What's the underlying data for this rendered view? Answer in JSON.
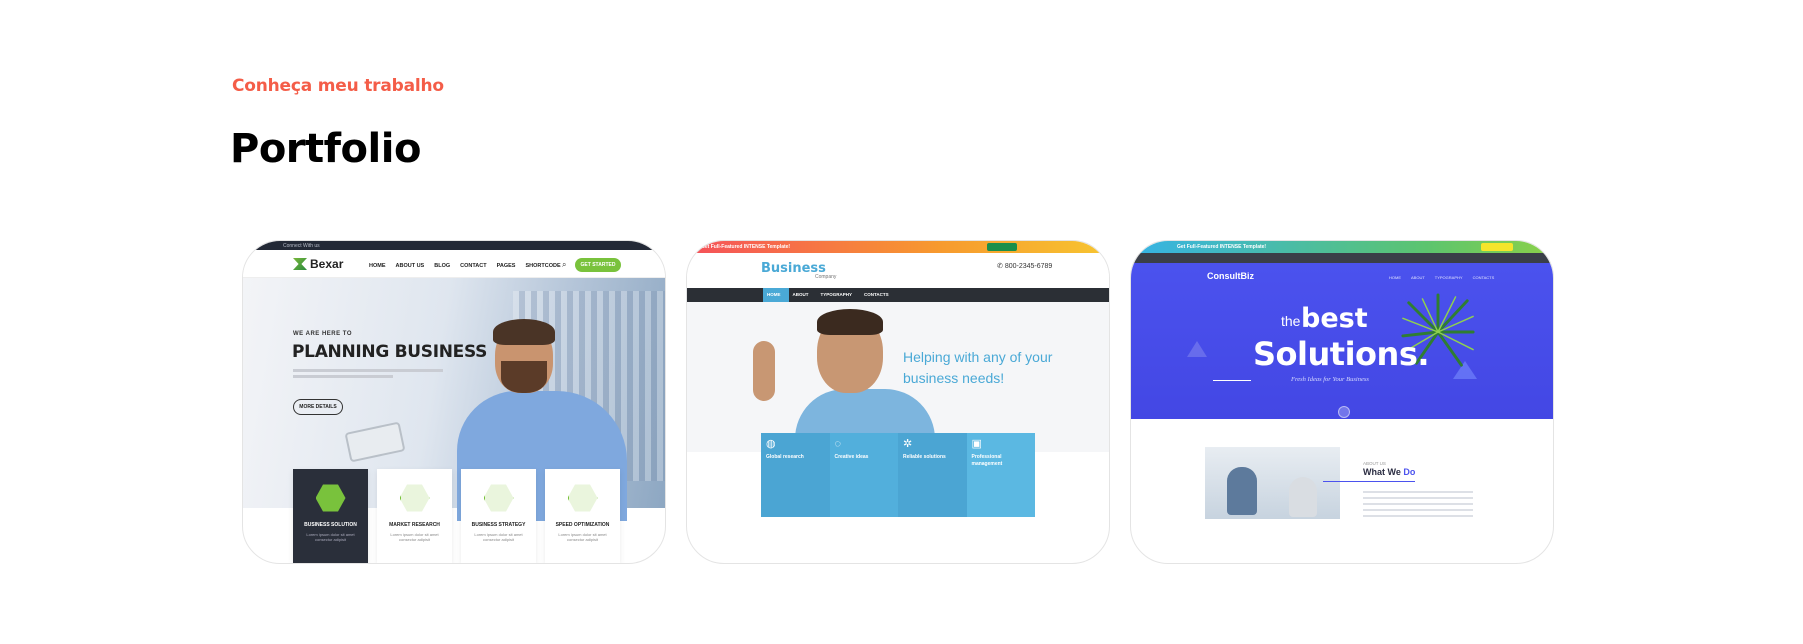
{
  "section": {
    "eyebrow": "Conheça meu trabalho",
    "title": "Portfolio"
  },
  "colors": {
    "accent": "#f45d48",
    "title": "#000000"
  },
  "portfolio": [
    {
      "name": "Bexar",
      "logo": "Bexar",
      "top_bar": "Connect With us",
      "menu": [
        "HOME",
        "ABOUT US",
        "BLOG",
        "CONTACT",
        "PAGES",
        "SHORTCODE"
      ],
      "cta": "GET STARTED",
      "hero_small": "WE ARE HERE TO",
      "hero_title": "PLANNING BUSINESS",
      "hero_button": "MORE DETAILS",
      "features": [
        {
          "title": "BUSINESS SOLUTION",
          "text": "Lorem ipsum dolor sit amet consectur adipisit",
          "icon": "diamond-icon"
        },
        {
          "title": "MARKET RESEARCH",
          "text": "Lorem ipsum dolor sit amet consectur adipisit",
          "icon": "chart-icon"
        },
        {
          "title": "BUSINESS STRATEGY",
          "text": "Lorem ipsum dolor sit amet consectur adipisit",
          "icon": "bulb-icon"
        },
        {
          "title": "SPEED OPTIMIZATION",
          "text": "Lorem ipsum dolor sit amet consectur adipisit",
          "icon": "gauge-icon"
        }
      ]
    },
    {
      "name": "Business Company",
      "top_bar": "Get Full-Featured INTENSE Template!",
      "logo": "Business",
      "logo_sub": "Company",
      "phone": "800-2345-6789",
      "menu": [
        "HOME",
        "ABOUT",
        "TYPOGRAPHY",
        "CONTACTS"
      ],
      "hero_title": "Helping with any of your business needs!",
      "features": [
        {
          "title": "Global research",
          "icon": "globe-icon"
        },
        {
          "title": "Creative ideas",
          "icon": "bulb-icon"
        },
        {
          "title": "Reliable solutions",
          "icon": "gear-icon"
        },
        {
          "title": "Professional management",
          "icon": "briefcase-icon"
        }
      ]
    },
    {
      "name": "ConsultBiz",
      "top_bar": "Get Full-Featured INTENSE Template!",
      "logo": "ConsultBiz",
      "menu": [
        "HOME",
        "ABOUT",
        "TYPOGRAPHY",
        "CONTACTS"
      ],
      "hero_the": "the",
      "hero_best": "best",
      "hero_title": "Solutions.",
      "hero_tag": "Fresh Ideas for Your Business",
      "about_small": "ABOUT US",
      "about_title_1": "What We ",
      "about_title_2": "Do"
    }
  ]
}
